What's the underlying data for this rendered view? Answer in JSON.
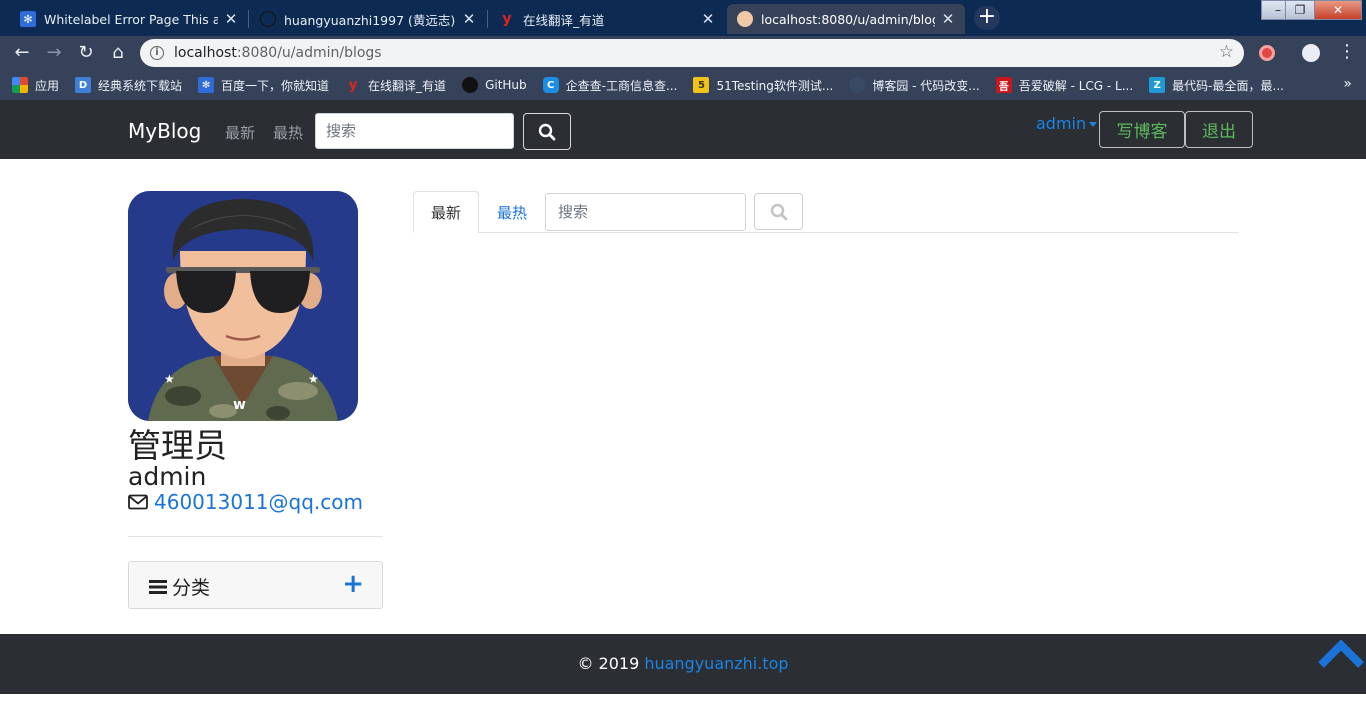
{
  "browser": {
    "tabs": [
      {
        "title": "Whitelabel Error Page This app",
        "active": false
      },
      {
        "title": "huangyuanzhi1997 (黄远志)",
        "active": false
      },
      {
        "title": "在线翻译_有道",
        "active": false
      },
      {
        "title": "localhost:8080/u/admin/blogs",
        "active": true
      }
    ],
    "new_tab_label": "+",
    "url_host": "localhost",
    "url_rest": ":8080/u/admin/blogs",
    "bookmarks": [
      {
        "label": "应用",
        "icon": "apps-grid-icon",
        "color": "#e04a2f"
      },
      {
        "label": "经典系统下载站",
        "icon": "site-favicon-icon",
        "color": "#3f7fd6"
      },
      {
        "label": "百度一下，你就知道",
        "icon": "baidu-paw-icon",
        "color": "#2f6cd8"
      },
      {
        "label": "在线翻译_有道",
        "icon": "youdao-icon",
        "color": "#e1251b"
      },
      {
        "label": "GitHub",
        "icon": "github-icon",
        "color": "#111111"
      },
      {
        "label": "企查查-工商信息查...",
        "icon": "qichacha-icon",
        "color": "#1a8fe3"
      },
      {
        "label": "51Testing软件测试...",
        "icon": "testing-icon",
        "color": "#f0c419"
      },
      {
        "label": "博客园 - 代码改变...",
        "icon": "cnblogs-icon",
        "color": "#3a4a66"
      },
      {
        "label": "吾爱破解 - LCG - L...",
        "icon": "52pojie-icon",
        "color": "#c8161d"
      },
      {
        "label": "最代码-最全面，最...",
        "icon": "zuidaima-icon",
        "color": "#1e9ad6"
      }
    ]
  },
  "navbar": {
    "brand": "MyBlog",
    "links": [
      "最新",
      "最热"
    ],
    "search_placeholder": "搜索",
    "user": "admin",
    "write_label": "写博客",
    "logout_label": "退出"
  },
  "profile": {
    "name_cn": "管理员",
    "username": "admin",
    "email": "460013011@qq.com",
    "category_label": "分类",
    "add_label": "+"
  },
  "blog_list": {
    "tabs": [
      "最新",
      "最热"
    ],
    "active_tab": "最新",
    "search_placeholder": "搜索"
  },
  "footer": {
    "copyright": "© 2019 ",
    "site_link": "huangyuanzhi.top"
  },
  "colors": {
    "accent": "#1a73d9",
    "navbar_bg": "#2b2f33",
    "success": "#5cb85c"
  }
}
